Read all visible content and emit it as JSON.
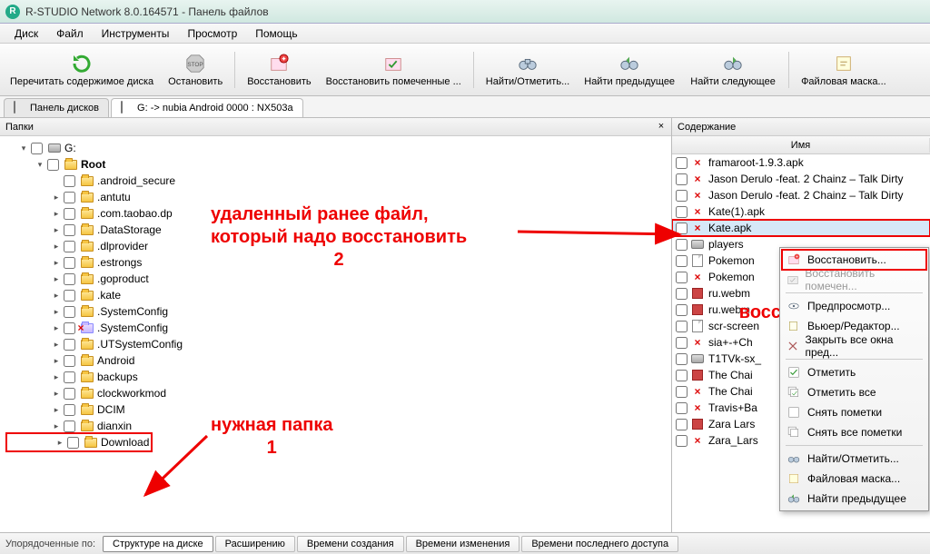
{
  "window": {
    "title": "R-STUDIO Network 8.0.164571 - Панель файлов"
  },
  "menus": [
    "Диск",
    "Файл",
    "Инструменты",
    "Просмотр",
    "Помощь"
  ],
  "toolbar": [
    {
      "id": "reread",
      "label": "Перечитать содержимое диска",
      "icon": "refresh"
    },
    {
      "id": "stop",
      "label": "Остановить",
      "icon": "stop"
    },
    {
      "id": "recover",
      "label": "Восстановить",
      "icon": "recover"
    },
    {
      "id": "recover-sel",
      "label": "Восстановить помеченные ...",
      "icon": "recover-selected"
    },
    {
      "id": "find",
      "label": "Найти/Отметить...",
      "icon": "find"
    },
    {
      "id": "findprev",
      "label": "Найти предыдущее",
      "icon": "find-prev"
    },
    {
      "id": "findnext",
      "label": "Найти следующее",
      "icon": "find-next"
    },
    {
      "id": "filemask",
      "label": "Файловая маска...",
      "icon": "mask"
    }
  ],
  "tabs": [
    {
      "id": "device-panel",
      "label": "Панель дисков",
      "icon": "disk"
    },
    {
      "id": "drive-g",
      "label": "G: -> nubia Android 0000 : NX503a",
      "icon": "disk",
      "active": true
    }
  ],
  "left_panel": {
    "title": "Папки",
    "tree": [
      {
        "depth": 0,
        "expanded": true,
        "icon": "disk",
        "label": "G:"
      },
      {
        "depth": 1,
        "expanded": true,
        "icon": "folder",
        "label": "Root",
        "bold": true
      },
      {
        "depth": 2,
        "icon": "folder",
        "label": ".android_secure"
      },
      {
        "depth": 2,
        "expandable": true,
        "icon": "folder",
        "label": ".antutu"
      },
      {
        "depth": 2,
        "expandable": true,
        "icon": "folder",
        "label": ".com.taobao.dp"
      },
      {
        "depth": 2,
        "expandable": true,
        "icon": "folder",
        "label": ".DataStorage"
      },
      {
        "depth": 2,
        "expandable": true,
        "icon": "folder",
        "label": ".dlprovider"
      },
      {
        "depth": 2,
        "expandable": true,
        "icon": "folder",
        "label": ".estrongs"
      },
      {
        "depth": 2,
        "expandable": true,
        "icon": "folder",
        "label": ".goproduct"
      },
      {
        "depth": 2,
        "expandable": true,
        "icon": "folder",
        "label": ".kate"
      },
      {
        "depth": 2,
        "expandable": true,
        "icon": "folder",
        "label": ".SystemConfig"
      },
      {
        "depth": 2,
        "expandable": true,
        "icon": "folder-del",
        "label": ".SystemConfig"
      },
      {
        "depth": 2,
        "expandable": true,
        "icon": "folder",
        "label": ".UTSystemConfig"
      },
      {
        "depth": 2,
        "expandable": true,
        "icon": "folder",
        "label": "Android"
      },
      {
        "depth": 2,
        "expandable": true,
        "icon": "folder",
        "label": "backups"
      },
      {
        "depth": 2,
        "expandable": true,
        "icon": "folder",
        "label": "clockworkmod"
      },
      {
        "depth": 2,
        "expandable": true,
        "icon": "folder",
        "label": "DCIM"
      },
      {
        "depth": 2,
        "expandable": true,
        "icon": "folder",
        "label": "dianxin"
      },
      {
        "depth": 2,
        "expandable": true,
        "icon": "folder",
        "label": "Download",
        "highlight": true
      }
    ]
  },
  "right_panel": {
    "title": "Содержание",
    "col_header": "Имя",
    "files": [
      {
        "icon": "redx",
        "label": "framaroot-1.9.3.apk"
      },
      {
        "icon": "redx",
        "label": "Jason Derulo -feat. 2 Chainz – Talk Dirty"
      },
      {
        "icon": "redx",
        "label": "Jason Derulo -feat. 2 Chainz – Talk Dirty"
      },
      {
        "icon": "redx",
        "label": "Kate(1).apk"
      },
      {
        "icon": "redx",
        "label": "Kate.apk",
        "highlight": true,
        "selected": true
      },
      {
        "icon": "disk",
        "label": "players"
      },
      {
        "icon": "file",
        "label": "Pokemon"
      },
      {
        "icon": "redx",
        "label": "Pokemon"
      },
      {
        "icon": "file-red",
        "label": "ru.webm"
      },
      {
        "icon": "file-red",
        "label": "ru.webm"
      },
      {
        "icon": "file",
        "label": "scr-screen"
      },
      {
        "icon": "redx",
        "label": "sia+-+Ch"
      },
      {
        "icon": "disk",
        "label": "T1TVk-sx_"
      },
      {
        "icon": "file-red",
        "label": "The Chai"
      },
      {
        "icon": "redx",
        "label": "The Chai"
      },
      {
        "icon": "redx",
        "label": "Travis+Ba"
      },
      {
        "icon": "file-red",
        "label": "Zara Lars"
      },
      {
        "icon": "redx",
        "label": "Zara_Lars"
      }
    ]
  },
  "context_menu": {
    "items": [
      {
        "id": "recover",
        "label": "Восстановить...",
        "icon": "recover",
        "highlight": true
      },
      {
        "id": "recover-m",
        "label": "Восстановить помечен...",
        "icon": "recover-selected",
        "disabled": true
      },
      {
        "sep": true
      },
      {
        "id": "preview",
        "label": "Предпросмотр...",
        "icon": "eye"
      },
      {
        "id": "viewer",
        "label": "Вьюер/Редактор...",
        "icon": "edit"
      },
      {
        "id": "closeall",
        "label": "Закрыть все окна пред...",
        "icon": "close"
      },
      {
        "sep": true
      },
      {
        "id": "mark",
        "label": "Отметить",
        "icon": "check"
      },
      {
        "id": "markall",
        "label": "Отметить все",
        "icon": "check-all"
      },
      {
        "id": "unmark",
        "label": "Снять пометки",
        "icon": "uncheck"
      },
      {
        "id": "unmarkall",
        "label": "Снять все пометки",
        "icon": "uncheck-all"
      },
      {
        "sep": true
      },
      {
        "id": "find",
        "label": "Найти/Отметить...",
        "icon": "find"
      },
      {
        "id": "filemask",
        "label": "Файловая маска...",
        "icon": "mask"
      },
      {
        "id": "findprev",
        "label": "Найти предыдущее",
        "icon": "find-prev"
      }
    ]
  },
  "bottom": {
    "label": "Упорядоченные по:",
    "buttons": [
      {
        "label": "Структуре на диске",
        "active": true
      },
      {
        "label": "Расширению"
      },
      {
        "label": "Времени создания"
      },
      {
        "label": "Времени изменения"
      },
      {
        "label": "Времени последнего доступа"
      }
    ]
  },
  "annotations": {
    "a1": {
      "text": "удаленный ранее файл,\nкоторый надо восстановить\n2"
    },
    "a2": {
      "text": "восстанавливаем\n3"
    },
    "a3": {
      "text": "нужная папка\n1"
    }
  }
}
